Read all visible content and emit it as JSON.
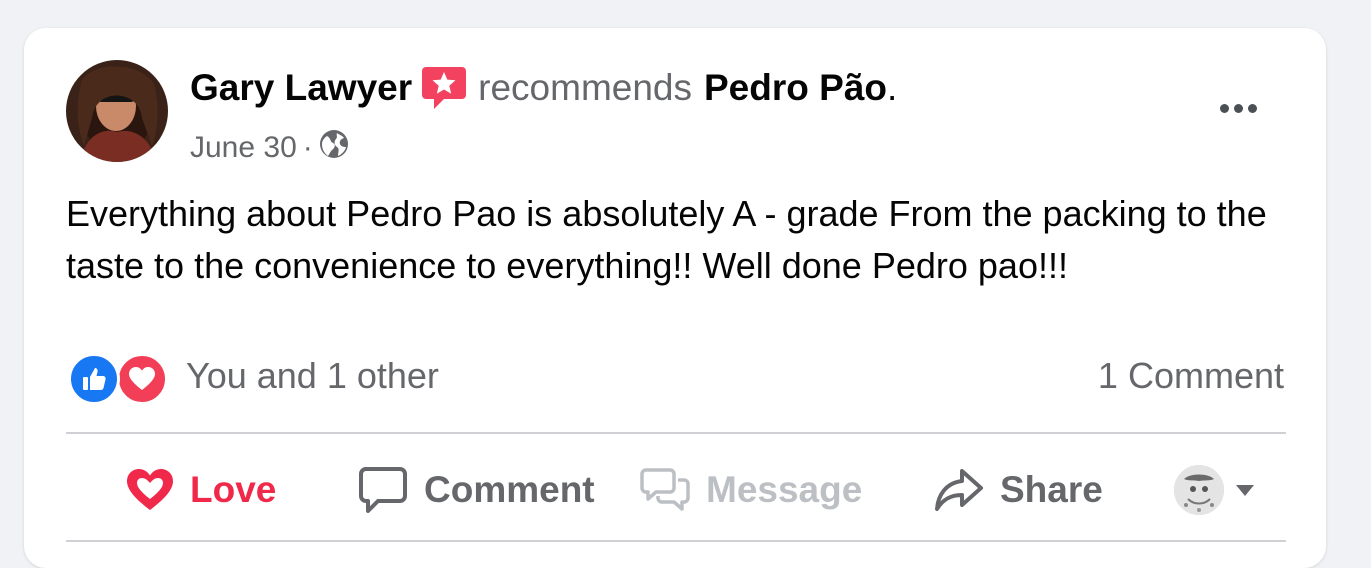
{
  "post": {
    "author": "Gary Lawyer",
    "recommends_label": "recommends",
    "page_name": "Pedro Pão",
    "page_name_suffix": ".",
    "date": "June 30",
    "separator": "·",
    "privacy_icon": "globe-icon",
    "body": "Everything about Pedro Pao is absolutely A - grade From the packing to the taste to the convenience to everything!! Well done Pedro pao!!!"
  },
  "reactions": {
    "icons": [
      "like-reaction-icon",
      "love-reaction-icon"
    ],
    "summary": "You and 1 other",
    "comment_count": "1 Comment"
  },
  "actions": {
    "love": "Love",
    "comment": "Comment",
    "message": "Message",
    "share": "Share"
  },
  "colors": {
    "love_red": "#f02849",
    "like_blue": "#1877f2",
    "secondary_text": "#65676b",
    "disabled_text": "#bcc0c4",
    "recommend_badge": "#f3425f"
  }
}
